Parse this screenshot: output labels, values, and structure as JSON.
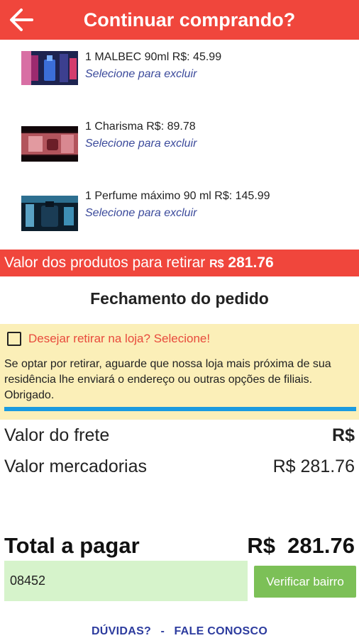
{
  "header": {
    "title": "Continuar comprando?",
    "back_icon": "arrow-left-icon"
  },
  "cart": {
    "items": [
      {
        "name": "1 MALBEC 90ml R$: 45.99",
        "hint": "Selecione para excluir"
      },
      {
        "name": "1 Charisma R$: 89.78",
        "hint": "Selecione para excluir"
      },
      {
        "name": "1 Perfume máximo 90 ml R$: 145.99",
        "hint": "Selecione para excluir"
      }
    ],
    "total_label": "Valor dos produtos para retirar",
    "total_currency": "R$",
    "total_value": "281.76"
  },
  "checkout": {
    "title": "Fechamento do pedido",
    "pickup_label": "Desejar retirar na loja? Selecione!",
    "pickup_note": "Se optar por retirar, aguarde que nossa loja mais próxima de sua residência lhe enviará o endereço ou outras opções de filiais. Obrigado.",
    "freight_label": "Valor do frete",
    "freight_value": "R$",
    "goods_label": "Valor mercadorias",
    "goods_value": "R$ 281.76",
    "total_label": "Total a pagar",
    "total_value": "R$  281.76"
  },
  "zip": {
    "value": "08452",
    "button": "Verificar bairro"
  },
  "footer": {
    "doubts": "DÚVIDAS?",
    "sep": "-",
    "contact": "FALE CONOSCO"
  },
  "colors": {
    "primary": "#f0463c",
    "button": "#7cc057",
    "link": "#2c3b9e",
    "accent_line": "#1b9be0"
  }
}
